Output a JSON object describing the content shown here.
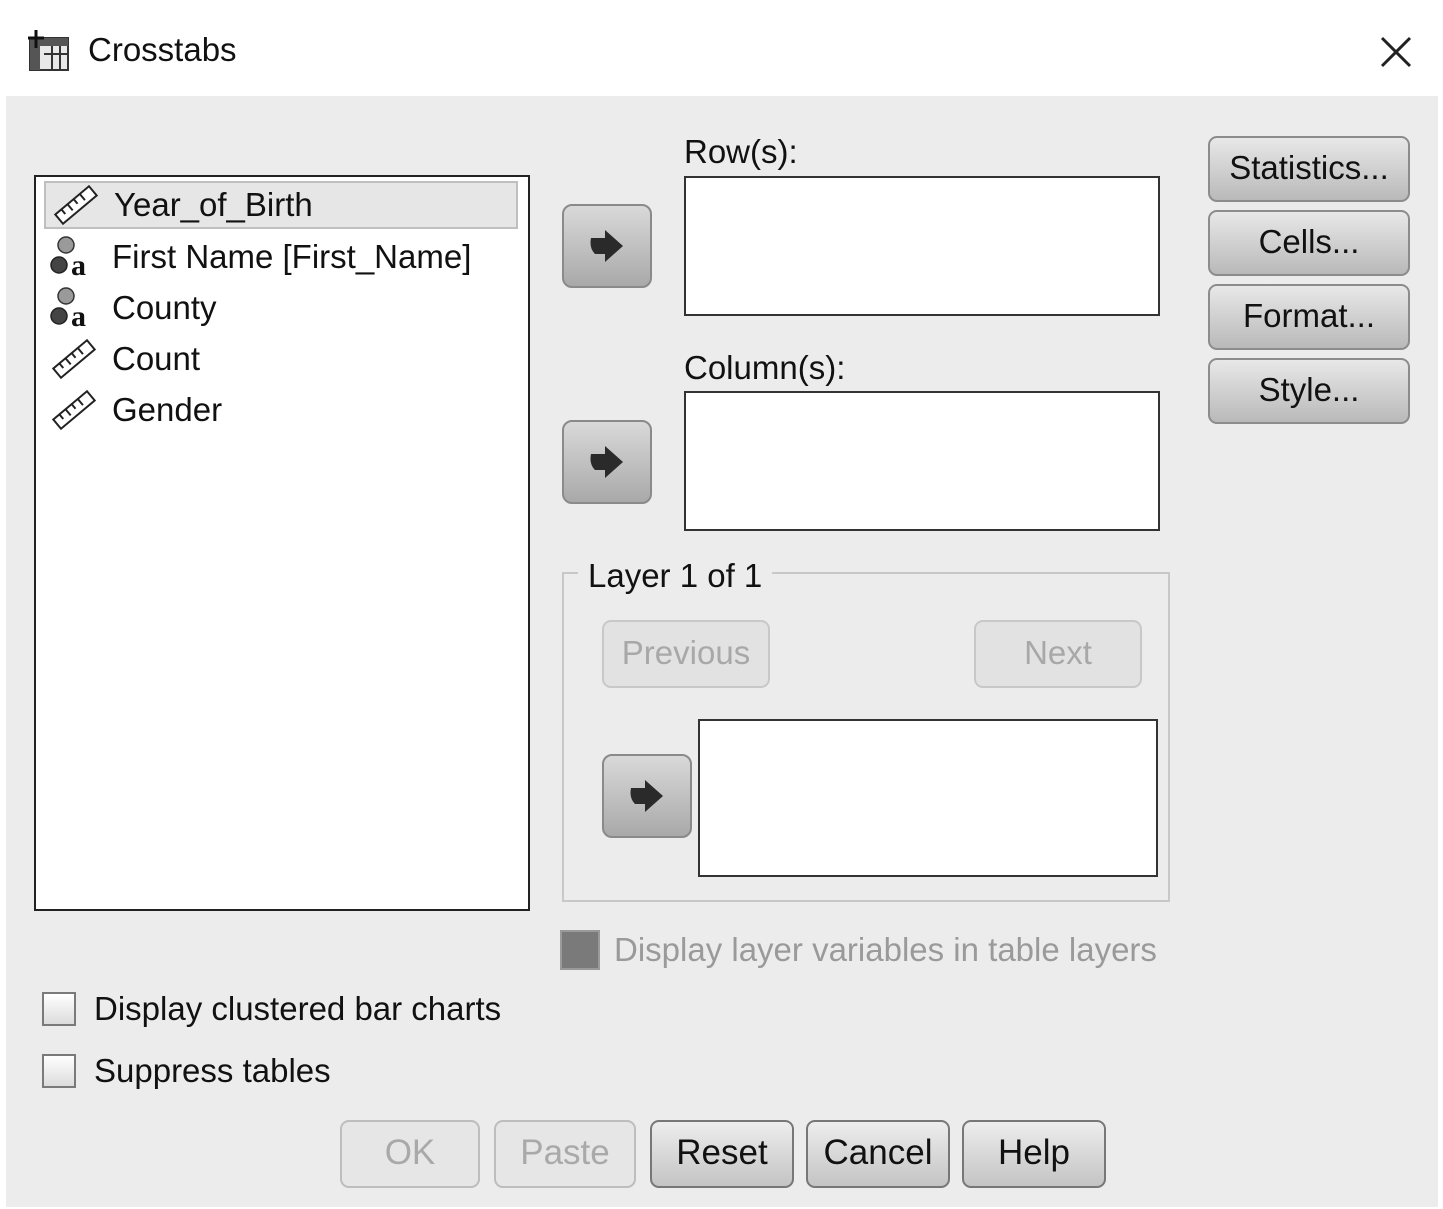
{
  "window": {
    "title": "Crosstabs"
  },
  "variables": [
    {
      "label": "Year_of_Birth",
      "icon": "ruler-icon",
      "selected": true
    },
    {
      "label": "First Name [First_Name]",
      "icon": "nominal-string-icon",
      "selected": false
    },
    {
      "label": "County",
      "icon": "nominal-string-icon",
      "selected": false
    },
    {
      "label": "Count",
      "icon": "ruler-icon",
      "selected": false
    },
    {
      "label": "Gender",
      "icon": "ruler-icon",
      "selected": false
    }
  ],
  "rows": {
    "label": "Row(s):"
  },
  "columns": {
    "label": "Column(s):"
  },
  "layer": {
    "legend": "Layer 1 of 1",
    "previous": "Previous",
    "next": "Next"
  },
  "side_buttons": {
    "statistics": "Statistics...",
    "cells": "Cells...",
    "format": "Format...",
    "style": "Style..."
  },
  "options": {
    "display_layer": "Display layer variables in table layers",
    "clustered_bars": "Display clustered bar charts",
    "suppress_tables": "Suppress tables"
  },
  "footer": {
    "ok": "OK",
    "paste": "Paste",
    "reset": "Reset",
    "cancel": "Cancel",
    "help": "Help"
  }
}
